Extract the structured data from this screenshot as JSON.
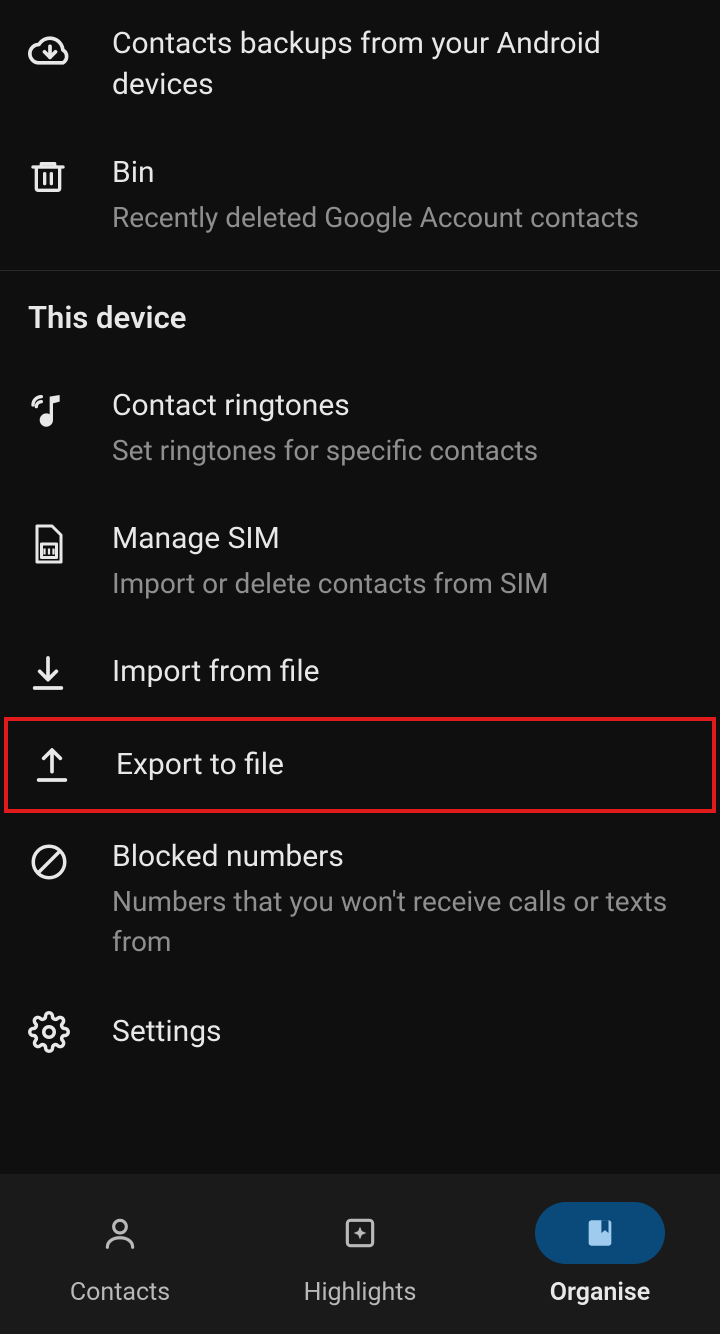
{
  "top_items": [
    {
      "title": "Contacts backups from your Android devices",
      "sub": null,
      "icon": "cloud-download-icon"
    },
    {
      "title": "Bin",
      "sub": "Recently deleted Google Account contacts",
      "icon": "trash-icon"
    }
  ],
  "section_header": "This device",
  "device_items": [
    {
      "title": "Contact ringtones",
      "sub": "Set ringtones for specific contacts",
      "icon": "ringtone-icon"
    },
    {
      "title": "Manage SIM",
      "sub": "Import or delete contacts from SIM",
      "icon": "sim-icon"
    },
    {
      "title": "Import from file",
      "sub": null,
      "icon": "download-icon"
    },
    {
      "title": "Export to file",
      "sub": null,
      "icon": "upload-icon"
    },
    {
      "title": "Blocked numbers",
      "sub": "Numbers that you won't receive calls or texts from",
      "icon": "block-icon"
    },
    {
      "title": "Settings",
      "sub": null,
      "icon": "gear-icon"
    }
  ],
  "nav": [
    {
      "label": "Contacts",
      "icon": "person-icon",
      "active": false
    },
    {
      "label": "Highlights",
      "icon": "sparkle-icon",
      "active": false
    },
    {
      "label": "Organise",
      "icon": "bookmark-tab-icon",
      "active": true
    }
  ]
}
